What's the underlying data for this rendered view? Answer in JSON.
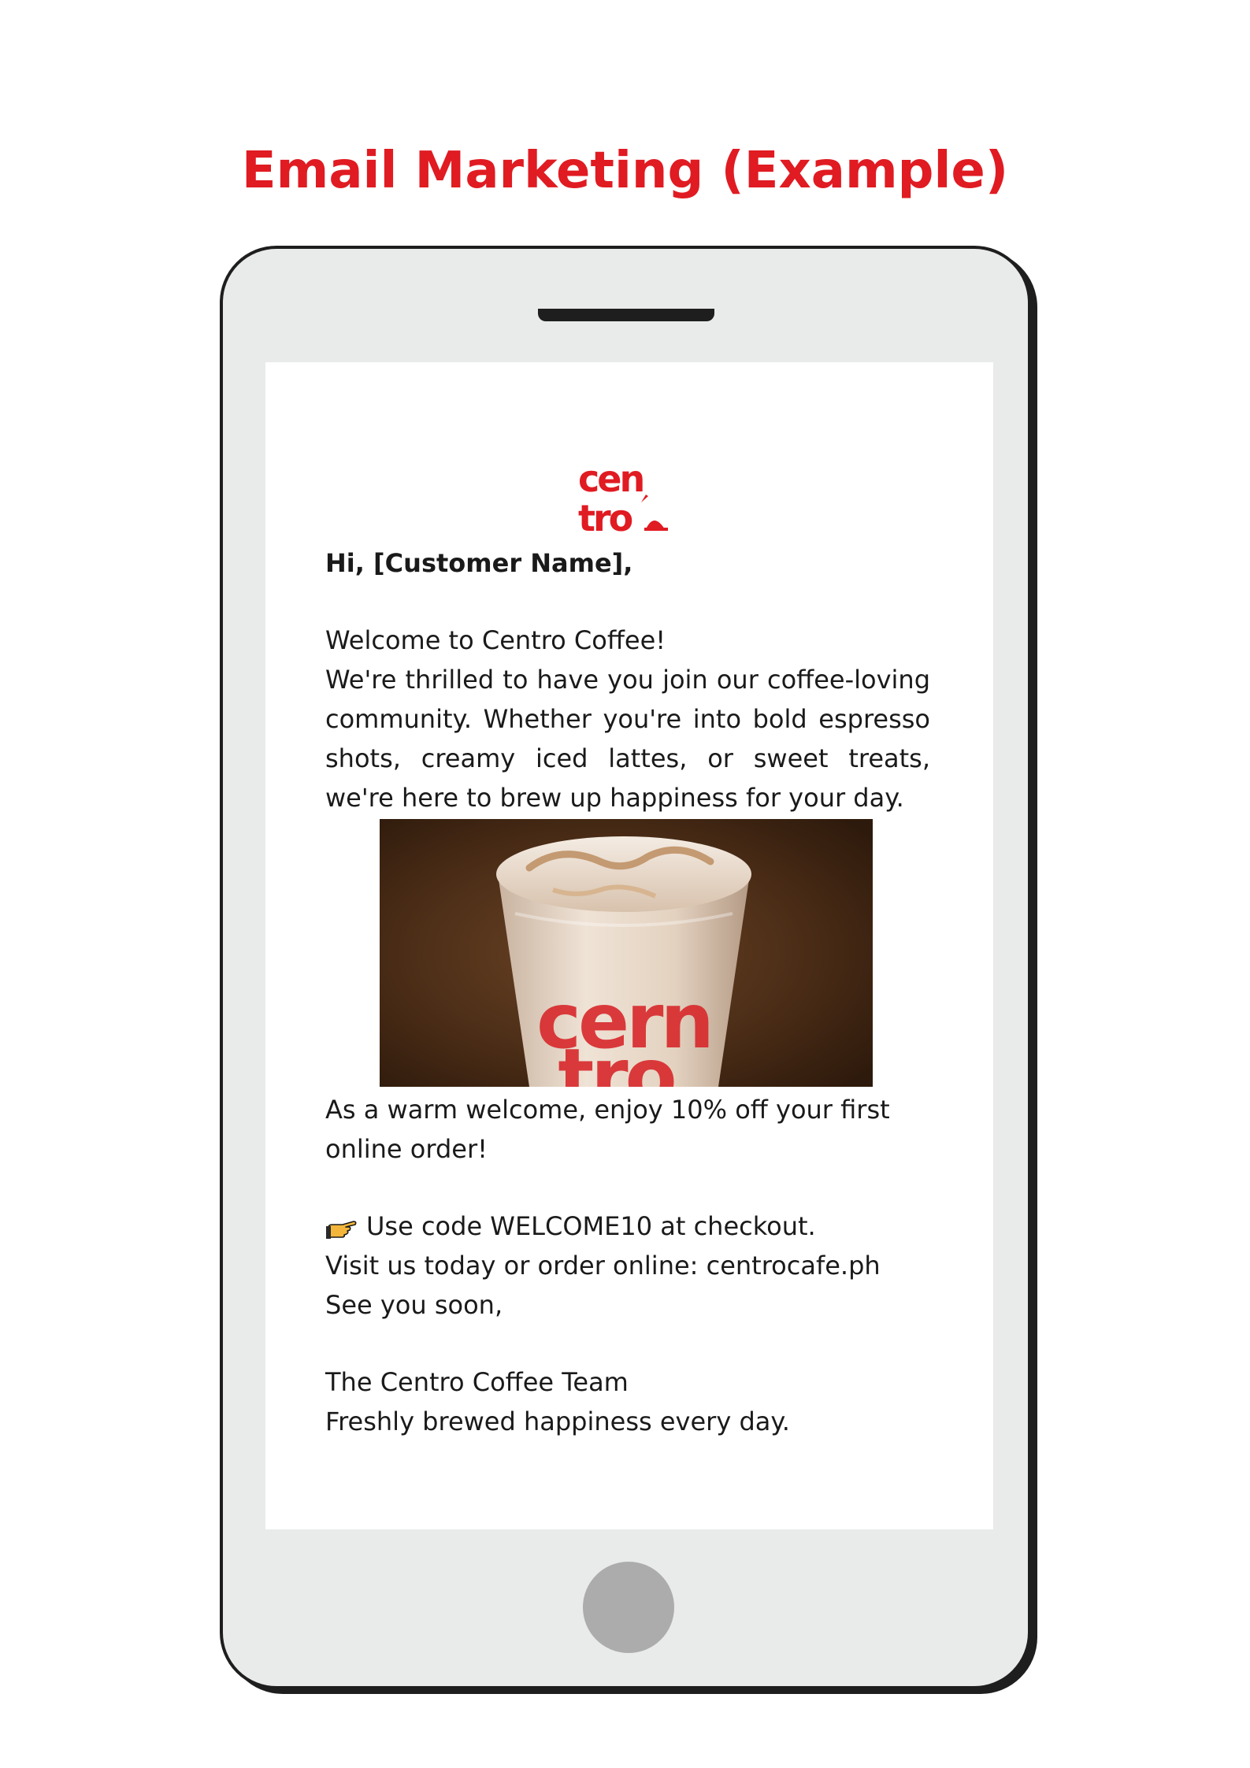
{
  "page": {
    "title": "Email Marketing (Example)",
    "accent_color": "#e01b22"
  },
  "phone": {
    "body_color": "#e9eaea",
    "frame_color": "#1e1e1e",
    "home_button_color": "#acacac"
  },
  "email": {
    "logo_text": "centro",
    "greeting": "Hi, [Customer Name],",
    "welcome_heading": "Welcome to Centro Coffee!",
    "intro_paragraph": "We're thrilled to have you join our coffee-loving community. Whether you're into bold espresso shots, creamy iced lattes, or sweet treats, we're here to brew up happiness for your day.",
    "product_image_icon": "iced-latte-cup-photo",
    "cup_print_text": "centro",
    "offer_text": "As a warm welcome, enjoy 10% off your first online order!",
    "code_icon": "pointing-hand-icon",
    "code_line": "Use code WELCOME10 at checkout.",
    "visit_line": "Visit us today or order online: centrocafe.ph",
    "closing_line": "See you soon,",
    "team_signature": "The Centro Coffee Team",
    "tagline": "Freshly brewed happiness every day."
  }
}
